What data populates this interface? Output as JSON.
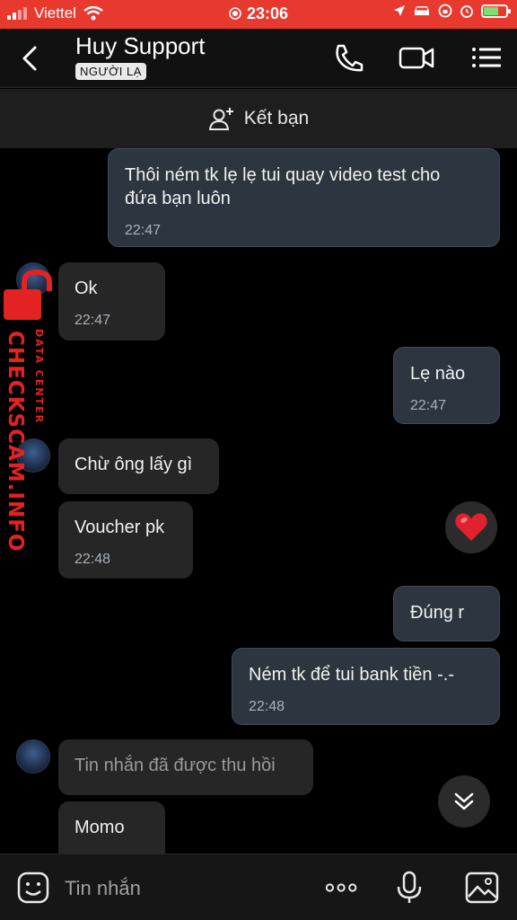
{
  "status_bar": {
    "carrier": "Viettel",
    "time": "23:06"
  },
  "header": {
    "title": "Huy Support",
    "badge": "NGƯỜI LẠ"
  },
  "add_friend": {
    "label": "Kết bạn"
  },
  "messages": [
    {
      "side": "mine",
      "text_line1": "Thôi ném tk lẹ lẹ tui quay video test cho",
      "text_line2": "đứa bạn luôn",
      "time": "22:47"
    },
    {
      "side": "theirs",
      "text": "Ok",
      "time": "22:47"
    },
    {
      "side": "mine",
      "text": "Lẹ nào",
      "time": "22:47"
    },
    {
      "side": "theirs",
      "text": "Chừ ông lấy gì"
    },
    {
      "side": "theirs",
      "text": "Voucher pk",
      "time": "22:48"
    },
    {
      "side": "mine",
      "text": "Đúng r"
    },
    {
      "side": "mine",
      "text": "Ném tk để tui bank tiền -.-",
      "time": "22:48"
    },
    {
      "side": "theirs",
      "text": "Tin nhắn đã được thu hồi"
    },
    {
      "side": "theirs",
      "text": "Momo"
    }
  ],
  "reaction": {
    "icon": "heart-icon",
    "color": "#e0212f"
  },
  "watermark": {
    "main": "CHECKSCAM.INFO",
    "sub": "DATA CENTER"
  },
  "composer": {
    "placeholder": "Tin nhắn"
  },
  "colors": {
    "status_bar": "#e8392f",
    "my_bubble": "#2d3640",
    "their_bubble": "#262626",
    "accent_red": "#e32222"
  }
}
